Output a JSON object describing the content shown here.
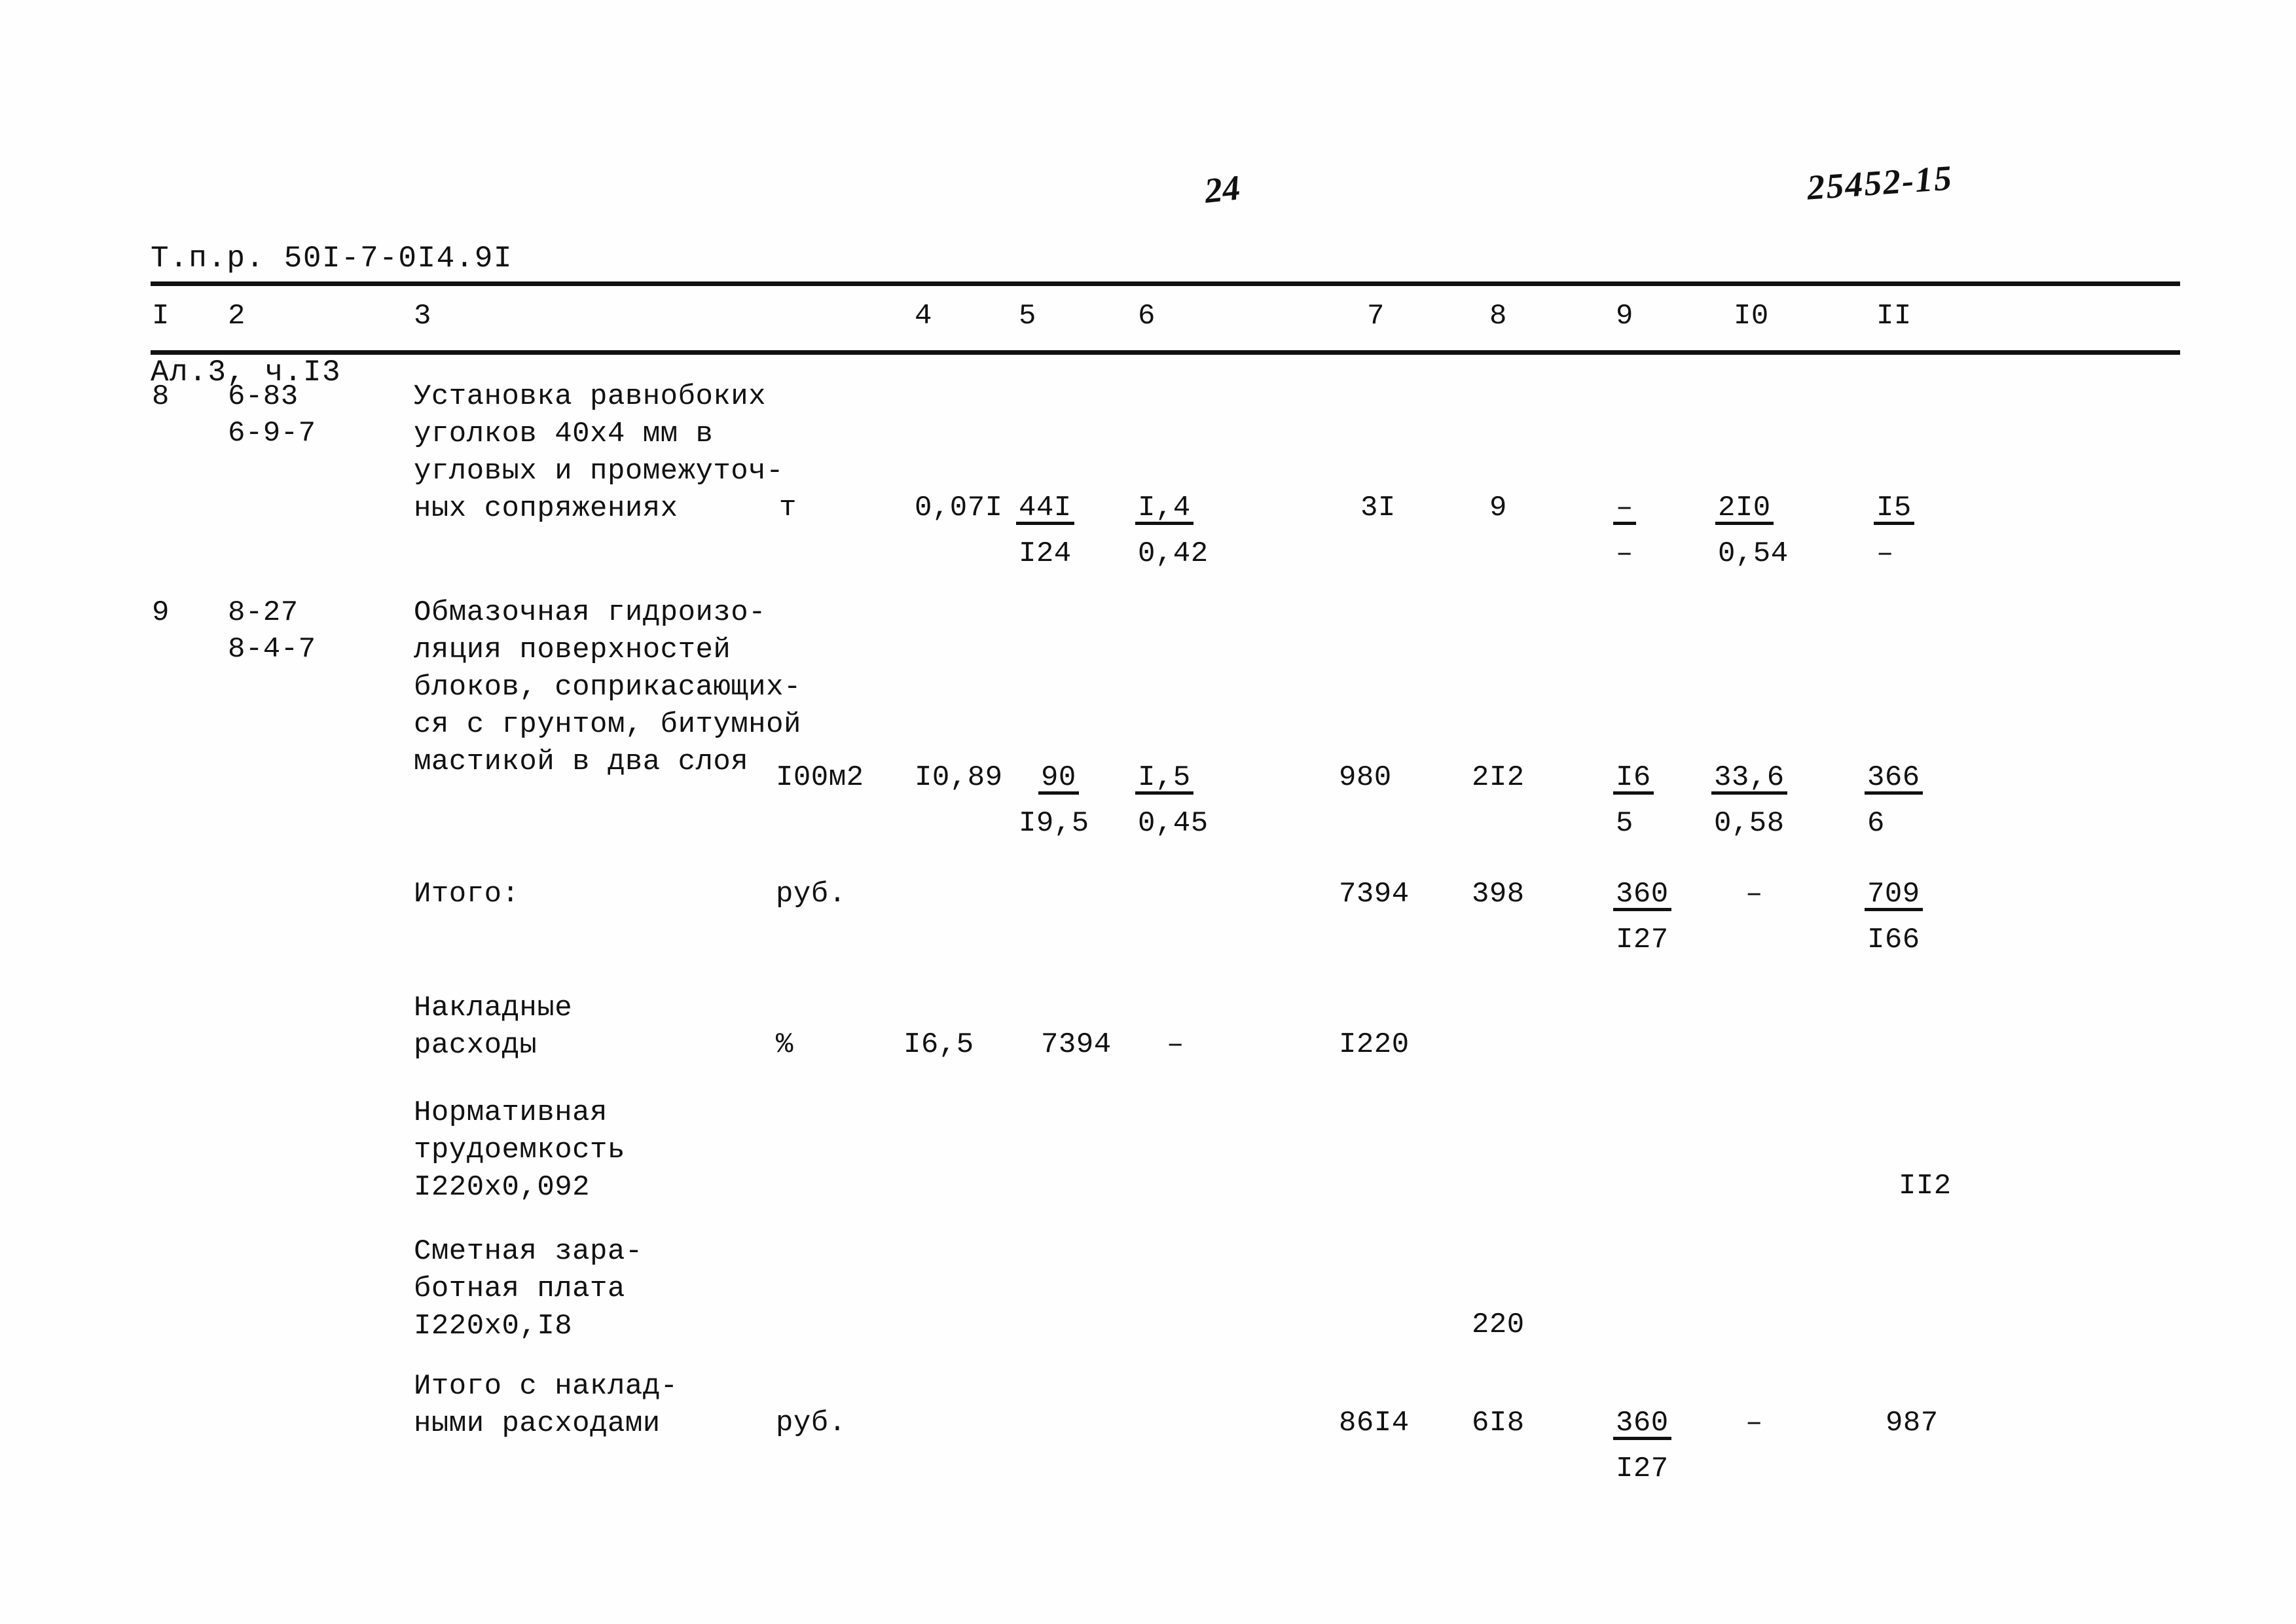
{
  "header": {
    "doc_code_line1": "Т.п.р. 50I-7-0I4.9I",
    "doc_code_line2": "Ал.3, ч.I3",
    "page_number": "24",
    "archive_number": "25452-15"
  },
  "table": {
    "column_headers": [
      "I",
      "2",
      "3",
      "4",
      "5",
      "6",
      "7",
      "8",
      "9",
      "I0",
      "II"
    ],
    "rows": [
      {
        "no": "8",
        "code_line1": "6-83",
        "code_line2": "6-9-7",
        "description": "Установка равнобоких\nуголков 40х4 мм в\nугловых и промежуточ-\nных сопряжениях",
        "unit": "т",
        "c4": "0,07I",
        "c5_top": "44I",
        "c5_bot": "I24",
        "c6_top": "I,4",
        "c6_bot": "0,42",
        "c7": "3I",
        "c8": "9",
        "c9_top": "–",
        "c9_bot": "–",
        "c10_top": "2I0",
        "c10_bot": "0,54",
        "c11_top": "I5",
        "c11_bot": "–"
      },
      {
        "no": "9",
        "code_line1": "8-27",
        "code_line2": "8-4-7",
        "description": "Обмазочная гидроизо-\nляция поверхностей\nблоков, соприкасающих-\nся с грунтом, битумной\nмастикой в два слоя",
        "unit": "I00м2",
        "c4": "I0,89",
        "c5_top": "90",
        "c5_bot": "I9,5",
        "c6_top": "I,5",
        "c6_bot": "0,45",
        "c7": "980",
        "c8": "2I2",
        "c9_top": "I6",
        "c9_bot": "5",
        "c10_top": "33,6",
        "c10_bot": "0,58",
        "c11_top": "366",
        "c11_bot": "6"
      }
    ],
    "summary_rows": [
      {
        "label": "Итого:",
        "unit": "руб.",
        "c7": "7394",
        "c8": "398",
        "c9_top": "360",
        "c9_bot": "I27",
        "c10_top": "–",
        "c11_top": "709",
        "c11_bot": "I66"
      },
      {
        "label": "Накладные\nрасходы",
        "unit": "%",
        "c4": "I6,5",
        "c5": "7394",
        "c6": "–",
        "c7": "I220"
      },
      {
        "label": "Нормативная\nтрудоемкость\nI220х0,092",
        "c11": "II2"
      },
      {
        "label": "Сметная зара-\nботная плата\nI220х0,I8",
        "c8": "220"
      },
      {
        "label": "Итого с наклад-\nными расходами",
        "unit": "руб.",
        "c7": "86I4",
        "c8": "6I8",
        "c9_top": "360",
        "c9_bot": "I27",
        "c10_top": "–",
        "c11": "987"
      }
    ]
  }
}
